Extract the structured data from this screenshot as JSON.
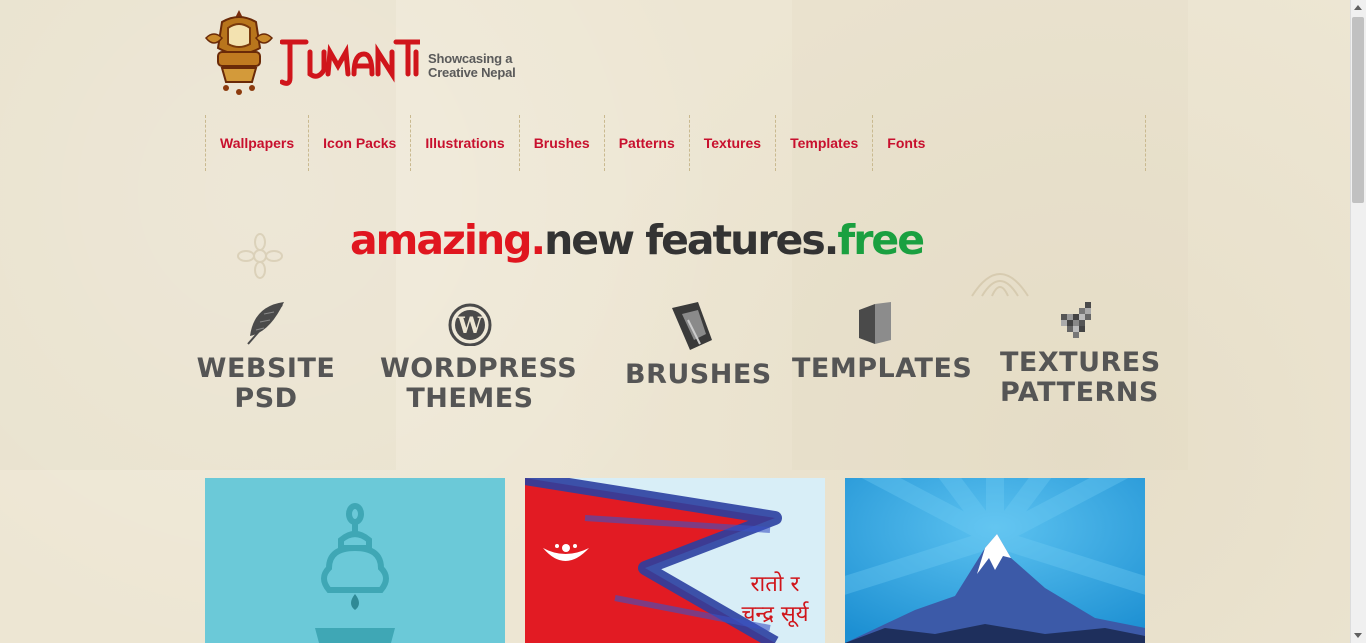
{
  "brand": {
    "name": "Jumanti",
    "tagline_line1": "Showcasing a",
    "tagline_line2": "Creative Nepal"
  },
  "nav": {
    "items": [
      {
        "label": "Wallpapers"
      },
      {
        "label": "Icon Packs"
      },
      {
        "label": "Illustrations"
      },
      {
        "label": "Brushes"
      },
      {
        "label": "Patterns"
      },
      {
        "label": "Textures"
      },
      {
        "label": "Templates"
      },
      {
        "label": "Fonts"
      }
    ]
  },
  "headline": {
    "part1": "amazing.",
    "part2": "new features.",
    "part3": "free"
  },
  "features": [
    {
      "icon": "feather-icon",
      "line1": "WEBSITE",
      "line2": "PSD"
    },
    {
      "icon": "wordpress-icon",
      "line1": "WORDPRESS",
      "line2": "THEMES"
    },
    {
      "icon": "brush-icon",
      "line1": "BRUSHES",
      "line2": ""
    },
    {
      "icon": "template-icon",
      "line1": "TEMPLATES",
      "line2": ""
    },
    {
      "icon": "texture-icon",
      "line1": "TEXTURES",
      "line2": "PATTERNS"
    }
  ],
  "thumbnails": [
    {
      "name": "lamp-illustration",
      "bg": "#6bc9d8"
    },
    {
      "name": "nepal-flag-wallpaper",
      "bg": "#d8eef7",
      "caption_line1": "रातो र",
      "caption_line2": "चन्द्र सूर्य"
    },
    {
      "name": "mountain-wallpaper",
      "bg": "#2a9fdc"
    }
  ],
  "colors": {
    "accent_red": "#c8102e",
    "headline_green": "#1aa040",
    "text_dark": "#555555"
  }
}
